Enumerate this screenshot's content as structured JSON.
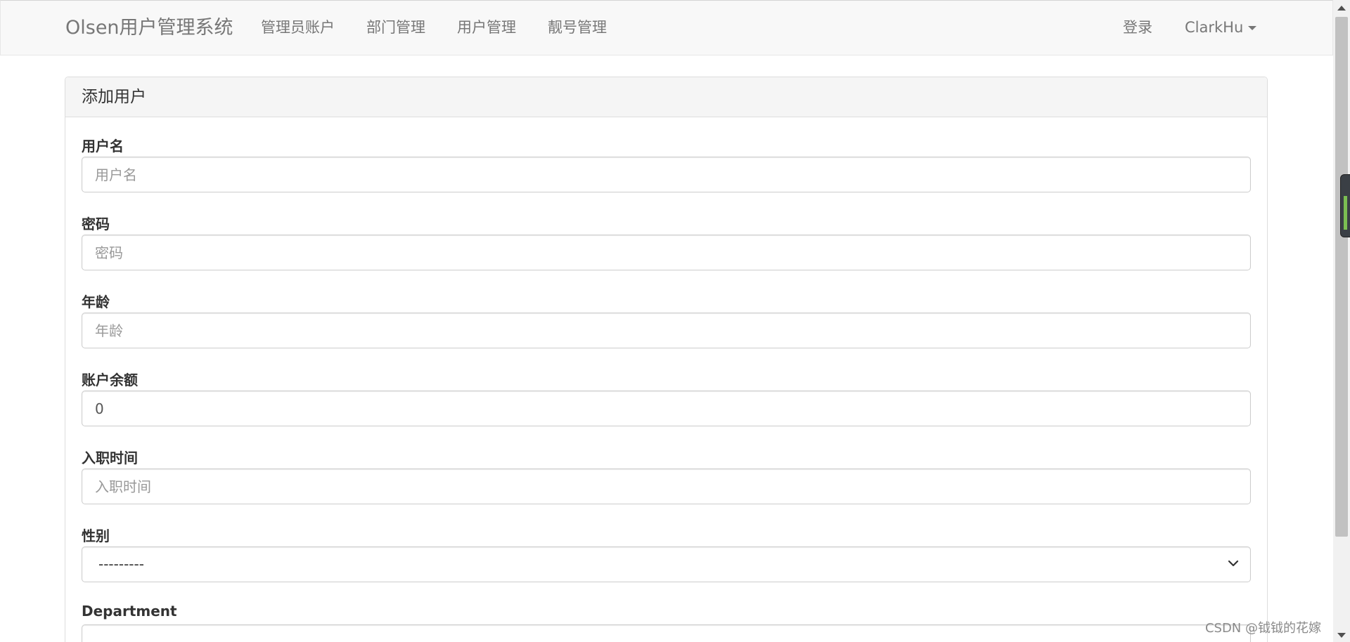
{
  "navbar": {
    "brand": "Olsen用户管理系统",
    "links": [
      "管理员账户",
      "部门管理",
      "用户管理",
      "靓号管理"
    ],
    "login": "登录",
    "user": "ClarkHu"
  },
  "panel": {
    "title": "添加用户"
  },
  "form": {
    "username": {
      "label": "用户名",
      "placeholder": "用户名",
      "value": ""
    },
    "password": {
      "label": "密码",
      "placeholder": "密码",
      "value": ""
    },
    "age": {
      "label": "年龄",
      "placeholder": "年龄",
      "value": ""
    },
    "balance": {
      "label": "账户余额",
      "placeholder": "",
      "value": "0"
    },
    "create_time": {
      "label": "入职时间",
      "placeholder": "入职时间",
      "value": ""
    },
    "gender": {
      "label": "性别",
      "selected": "---------"
    },
    "department": {
      "label": "Department"
    }
  },
  "watermark": "CSDN @钺钺的花嫁",
  "icons": {
    "caret": "caret-down-icon",
    "select_chevron": "chevron-down-icon"
  }
}
